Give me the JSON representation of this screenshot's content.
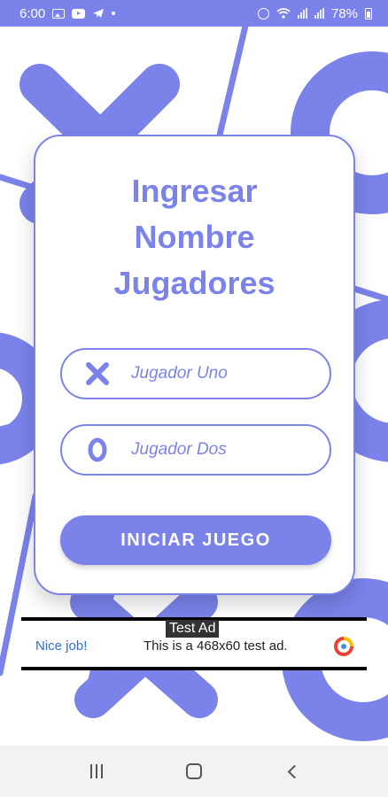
{
  "status_bar": {
    "time": "6:00",
    "battery": "78%",
    "icons": [
      "gallery-icon",
      "youtube-icon",
      "telegram-icon",
      "dot-icon",
      "alarm-icon",
      "wifi-icon",
      "signal-icon",
      "battery-icon"
    ]
  },
  "colors": {
    "accent": "#7b83eb",
    "status_bar": "#7b83eb",
    "card_bg": "#ffffff",
    "ad_link": "#2b6fd1",
    "nav_bar": "#f2f2f2"
  },
  "card": {
    "title_line1": "Ingresar",
    "title_line2": "Nombre",
    "title_line3": "Jugadores",
    "player_one": {
      "icon": "x-icon",
      "placeholder": "Jugador Uno",
      "value": ""
    },
    "player_two": {
      "icon": "o-icon",
      "placeholder": "Jugador Dos",
      "value": ""
    },
    "start_label": "INICIAR JUEGO"
  },
  "ad": {
    "label": "Test Ad",
    "nice": "Nice job!",
    "text": "This is a 468x60 test ad.",
    "logo_icon": "admob-logo-icon"
  },
  "nav_bar": {
    "icons": [
      "recent-apps-icon",
      "home-icon",
      "back-icon"
    ]
  }
}
